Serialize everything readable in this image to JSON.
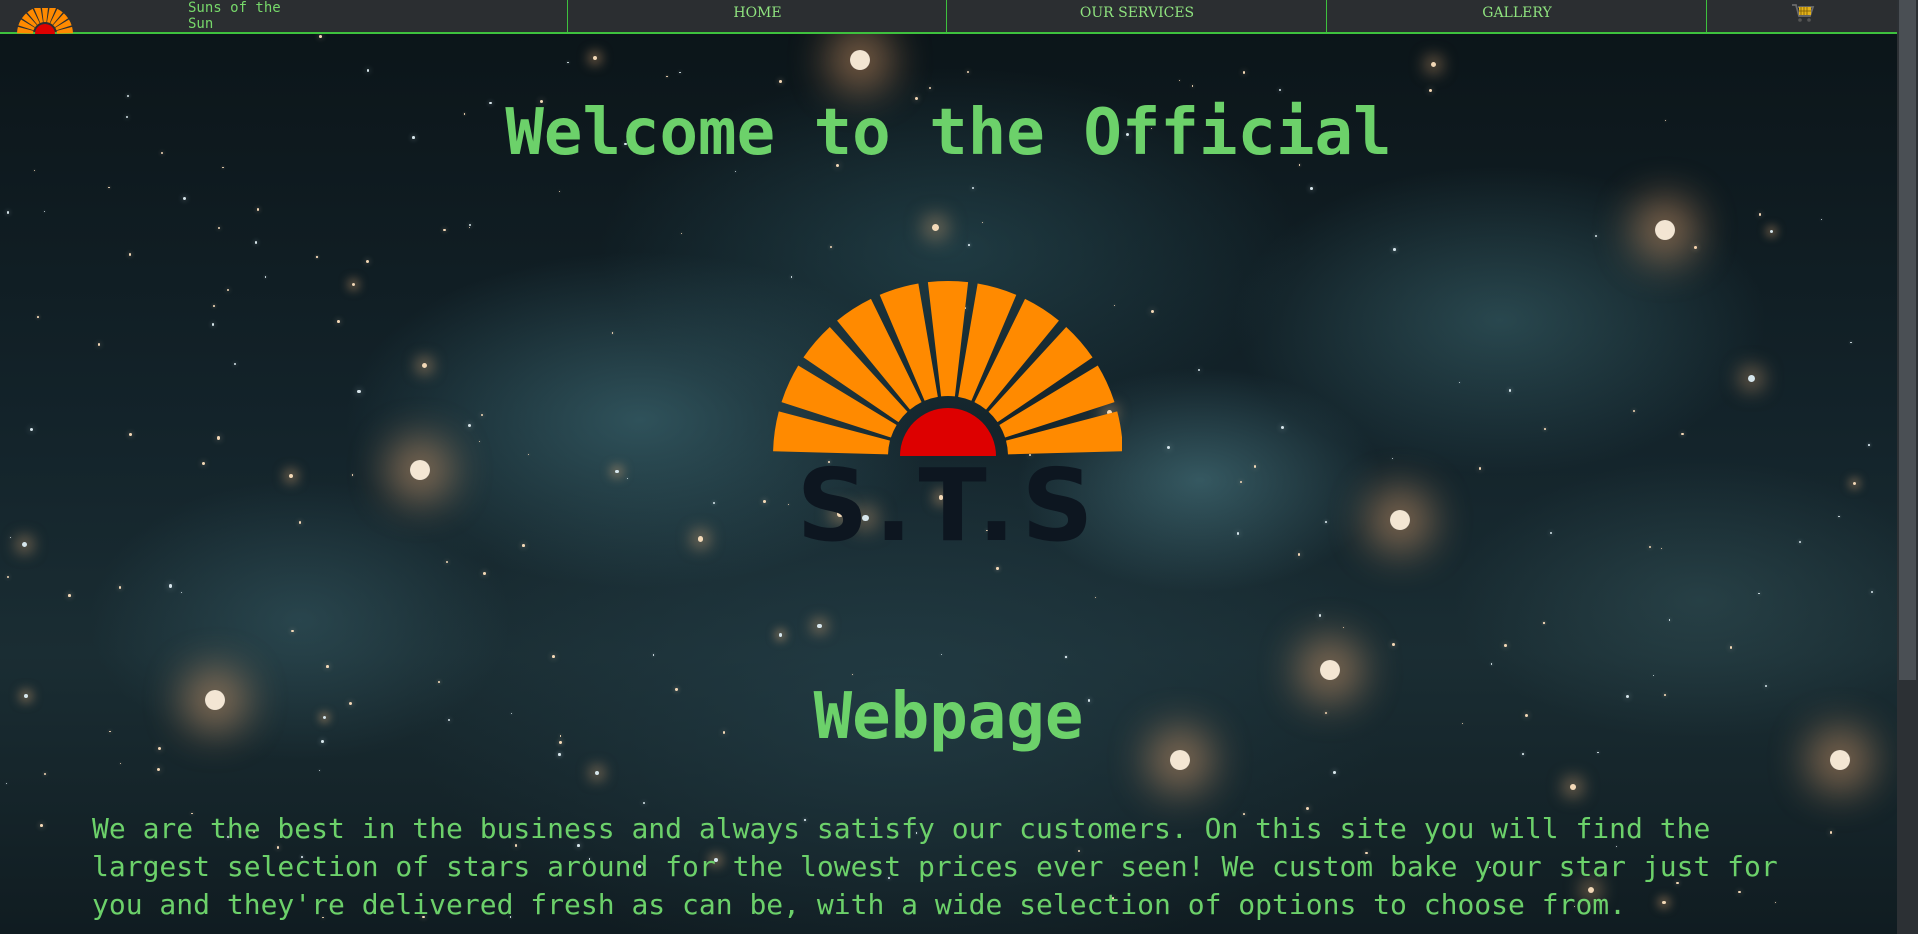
{
  "nav": {
    "brand": "Suns of the Sun",
    "items": [
      {
        "label": "HOME"
      },
      {
        "label": "OUR SERVICES"
      },
      {
        "label": "GALLERY"
      }
    ],
    "cart_icon": "cart-icon"
  },
  "hero": {
    "title_line1": "Welcome to the Official",
    "title_line2": "Webpage",
    "logo_text": "S.T.S"
  },
  "intro": {
    "text": "We are the best in the business and always satisfy our customers. On this site you will find the largest selection of stars around for the lowest prices ever seen! We custom bake your star just for you and they're delivered fresh as can be, with a wide selection of options to choose from."
  },
  "colors": {
    "accent": "#6cd16a",
    "nav_bg": "#2b2e31",
    "nav_border": "#3ec13e",
    "sun_rays": "#ff8a00",
    "sun_core": "#dd0000"
  }
}
